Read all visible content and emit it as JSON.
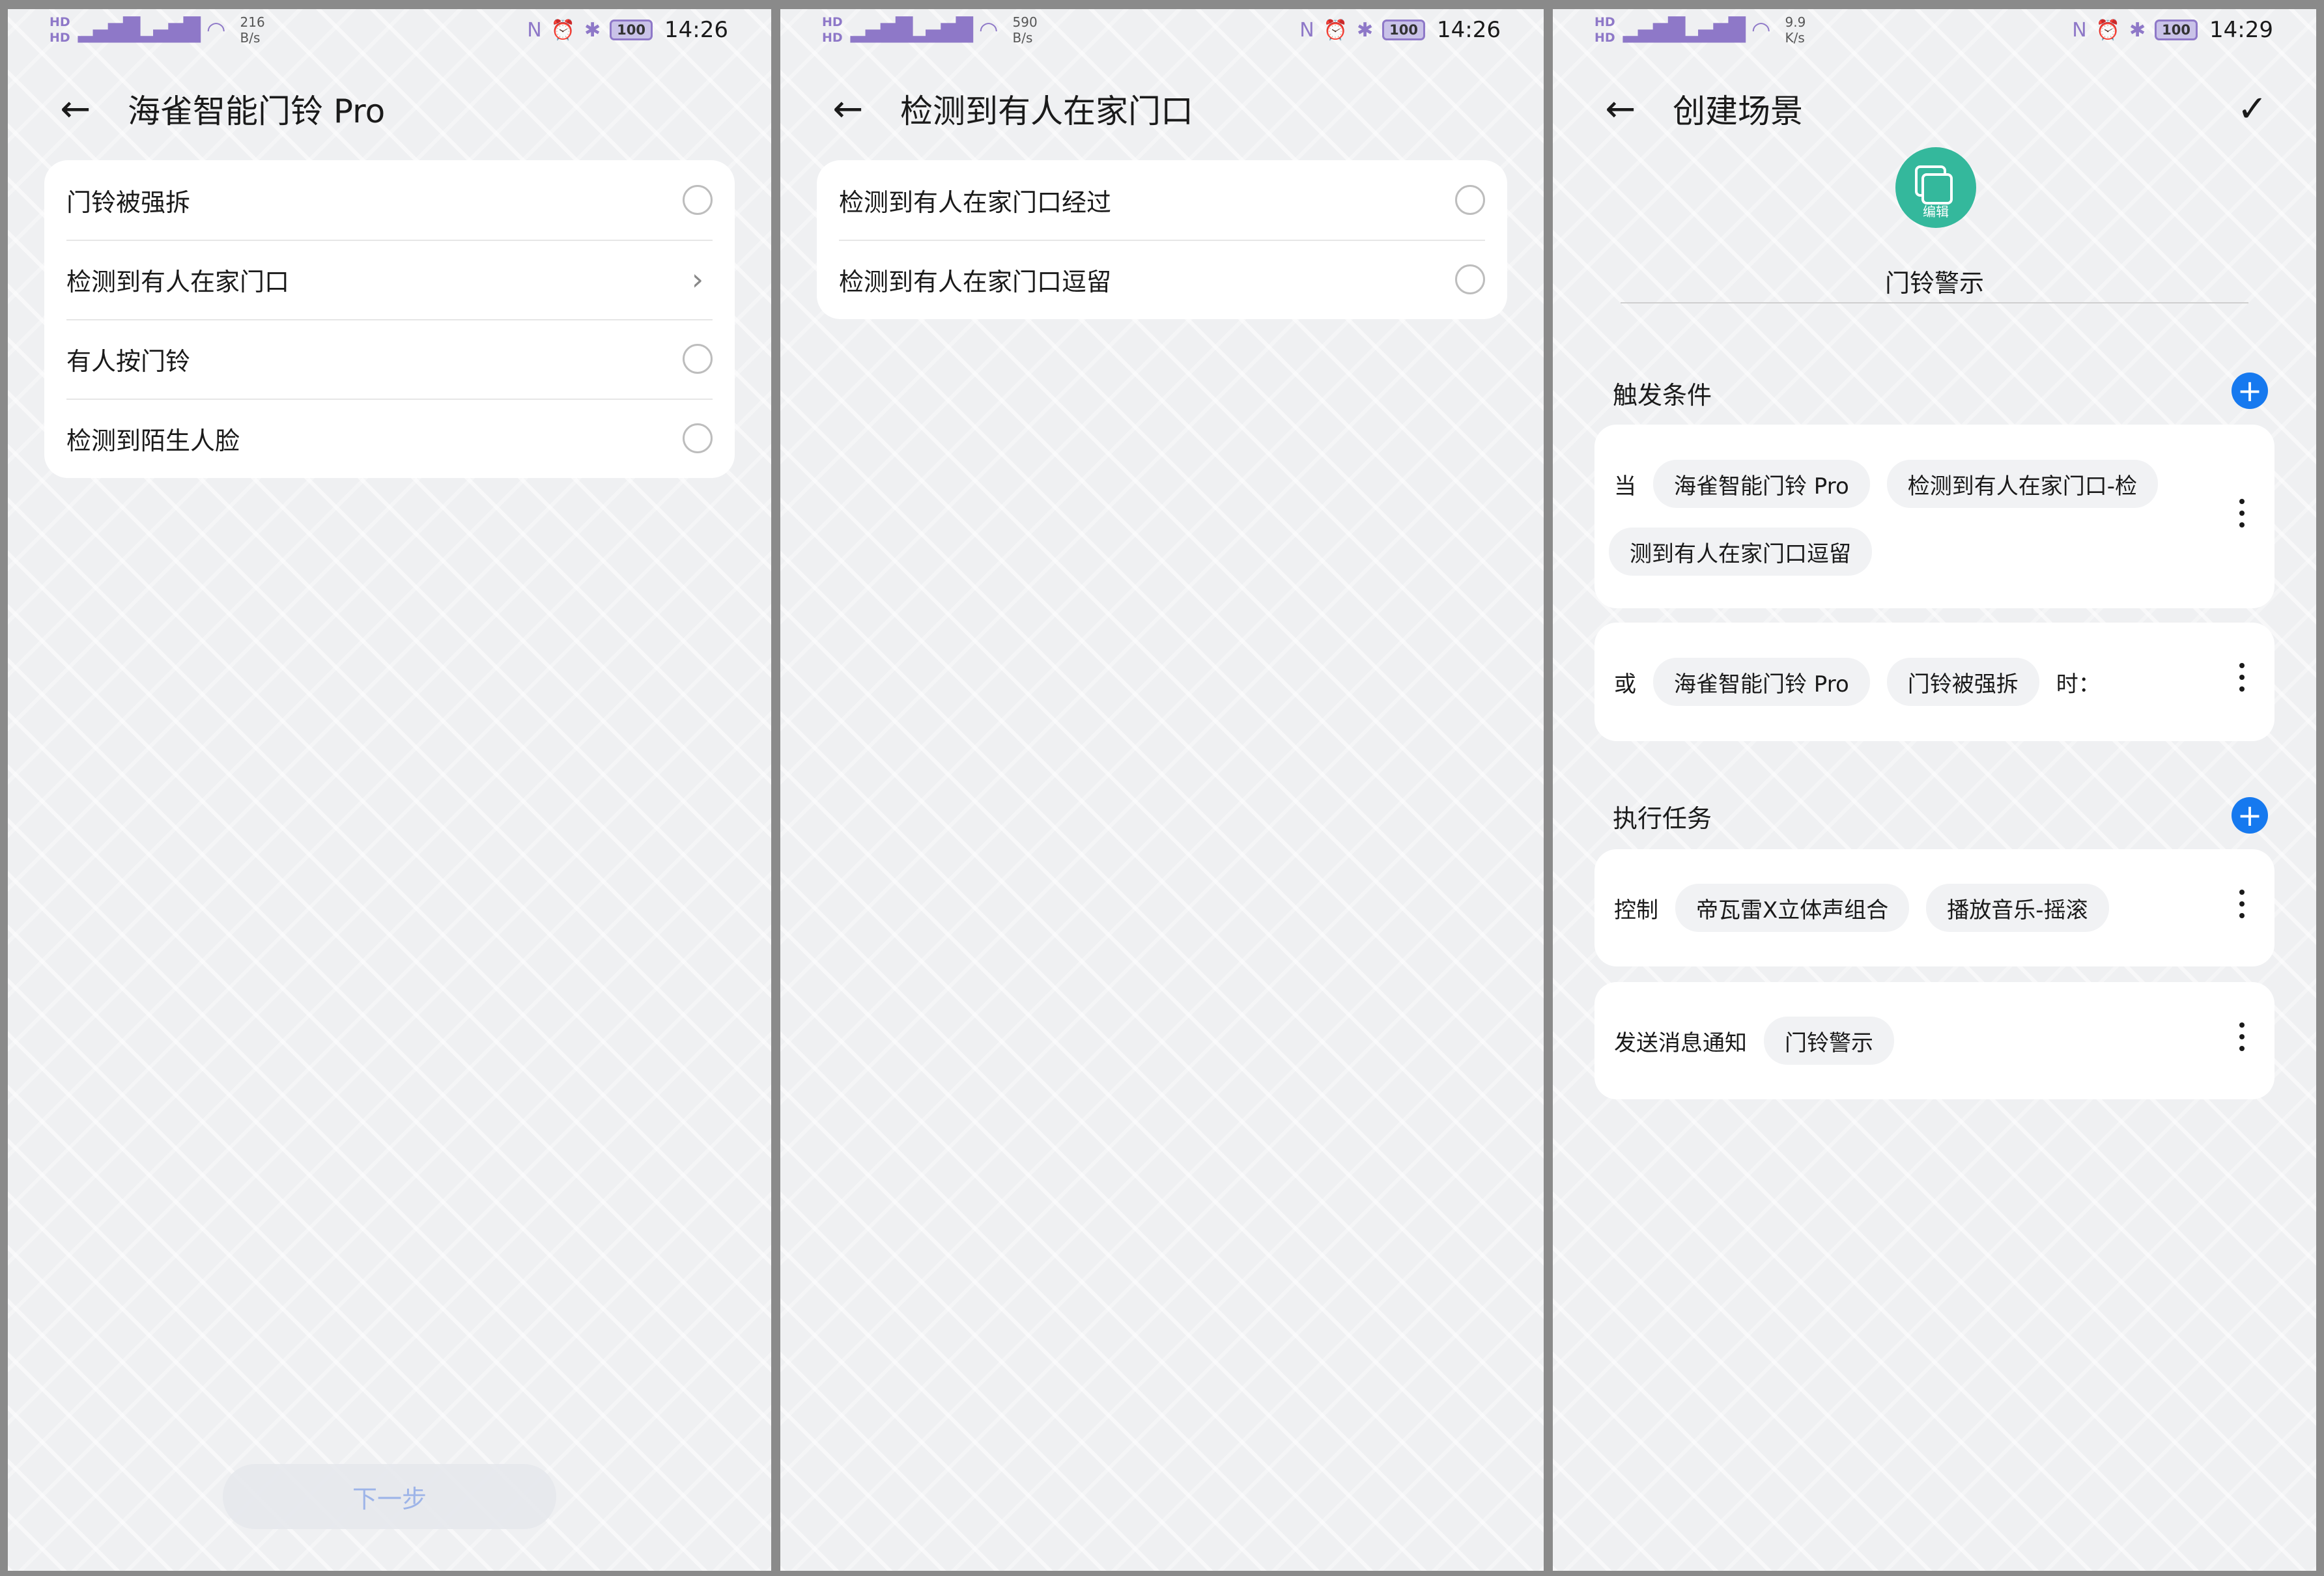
{
  "screens": [
    {
      "status": {
        "net_speed_value": "216",
        "net_speed_unit": "B/s",
        "battery": "100",
        "time": "14:26"
      },
      "title": "海雀智能门铃 Pro",
      "options": [
        {
          "label": "门铃被强拆",
          "control": "radio"
        },
        {
          "label": "检测到有人在家门口",
          "control": "chevron"
        },
        {
          "label": "有人按门铃",
          "control": "radio"
        },
        {
          "label": "检测到陌生人脸",
          "control": "radio"
        }
      ],
      "next_button": "下一步"
    },
    {
      "status": {
        "net_speed_value": "590",
        "net_speed_unit": "B/s",
        "battery": "100",
        "time": "14:26"
      },
      "title": "检测到有人在家门口",
      "options": [
        {
          "label": "检测到有人在家门口经过",
          "control": "radio"
        },
        {
          "label": "检测到有人在家门口逗留",
          "control": "radio"
        }
      ]
    },
    {
      "status": {
        "net_speed_value": "9.9",
        "net_speed_unit": "K/s",
        "battery": "100",
        "time": "14:29"
      },
      "title": "创建场景",
      "avatar_edit_label": "编辑",
      "scene_name": "门铃警示",
      "trigger_section": "触发条件",
      "conditions": [
        {
          "prefix": "当",
          "chips": [
            "海雀智能门铃 Pro",
            "检测到有人在家门口-检"
          ],
          "wrap_chip": "测到有人在家门口逗留"
        },
        {
          "prefix": "或",
          "chips": [
            "海雀智能门铃 Pro",
            "门铃被强拆"
          ],
          "suffix": "时："
        }
      ],
      "task_section": "执行任务",
      "tasks": [
        {
          "prefix": "控制",
          "chips": [
            "帝瓦雷X立体声组合",
            "播放音乐-摇滚"
          ]
        },
        {
          "prefix": "发送消息通知",
          "chips": [
            "门铃警示"
          ]
        }
      ]
    }
  ],
  "icons": {
    "back": "arrow-left-icon",
    "confirm": "check-icon",
    "add": "plus-icon",
    "more": "more-vertical-icon",
    "chevron": "chevron-right-icon",
    "nfc": "nfc-icon",
    "alarm": "alarm-icon",
    "bluetooth": "bluetooth-icon",
    "wifi": "wifi-icon",
    "signal": "signal-icon"
  },
  "colors": {
    "accent": "#1679ef",
    "avatar": "#34b89c",
    "status_icons": "#8e78c8",
    "next_disabled_text": "#9db4e8"
  }
}
